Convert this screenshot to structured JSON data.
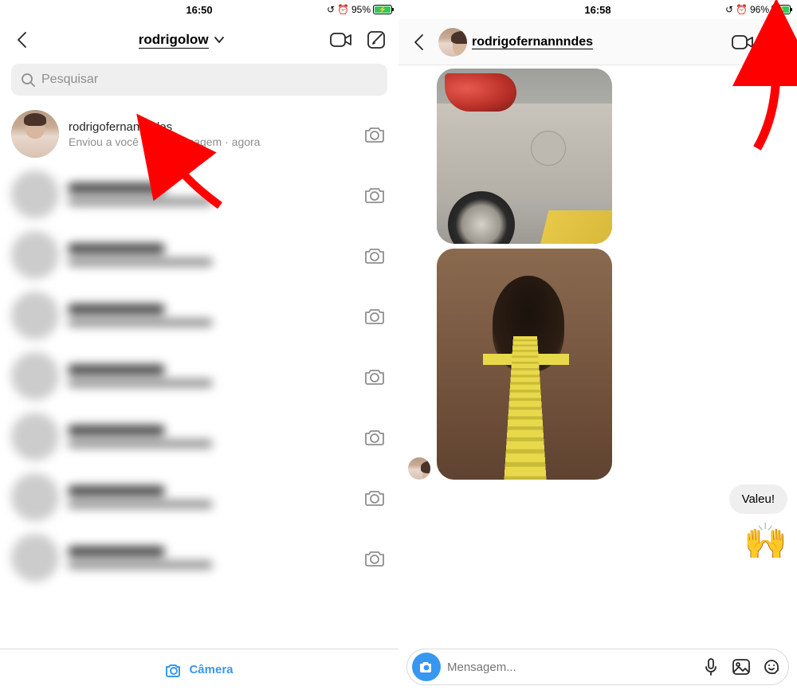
{
  "left": {
    "status": {
      "time": "16:50",
      "battery_pct": "95%"
    },
    "header": {
      "account": "rodrigolow"
    },
    "search": {
      "placeholder": "Pesquisar"
    },
    "threads": [
      {
        "name": "rodrigofernannndes",
        "subtitle": "Enviou a você uma mensagem · agora"
      }
    ],
    "blurred_thread_count": 7,
    "footer": {
      "camera_label": "Câmera"
    }
  },
  "right": {
    "status": {
      "time": "16:58",
      "battery_pct": "96%"
    },
    "header": {
      "username": "rodrigofernannndes"
    },
    "messages": {
      "outgoing_text": "Valeu!",
      "outgoing_emoji": "🙌"
    },
    "composer": {
      "placeholder": "Mensagem..."
    }
  },
  "icons": {
    "back": "chevron-left",
    "dropdown": "chevron-down",
    "video": "video-camera",
    "compose": "pencil-square",
    "search": "magnifier",
    "camera_outline": "camera",
    "info": "info-circle",
    "camera_fill": "camera-filled",
    "mic": "microphone",
    "gallery": "image",
    "sticker": "sticker-face"
  },
  "colors": {
    "accent": "#3897f0",
    "grey": "#8e8e8e",
    "bubble": "#efefef",
    "arrow": "#ff0000"
  }
}
